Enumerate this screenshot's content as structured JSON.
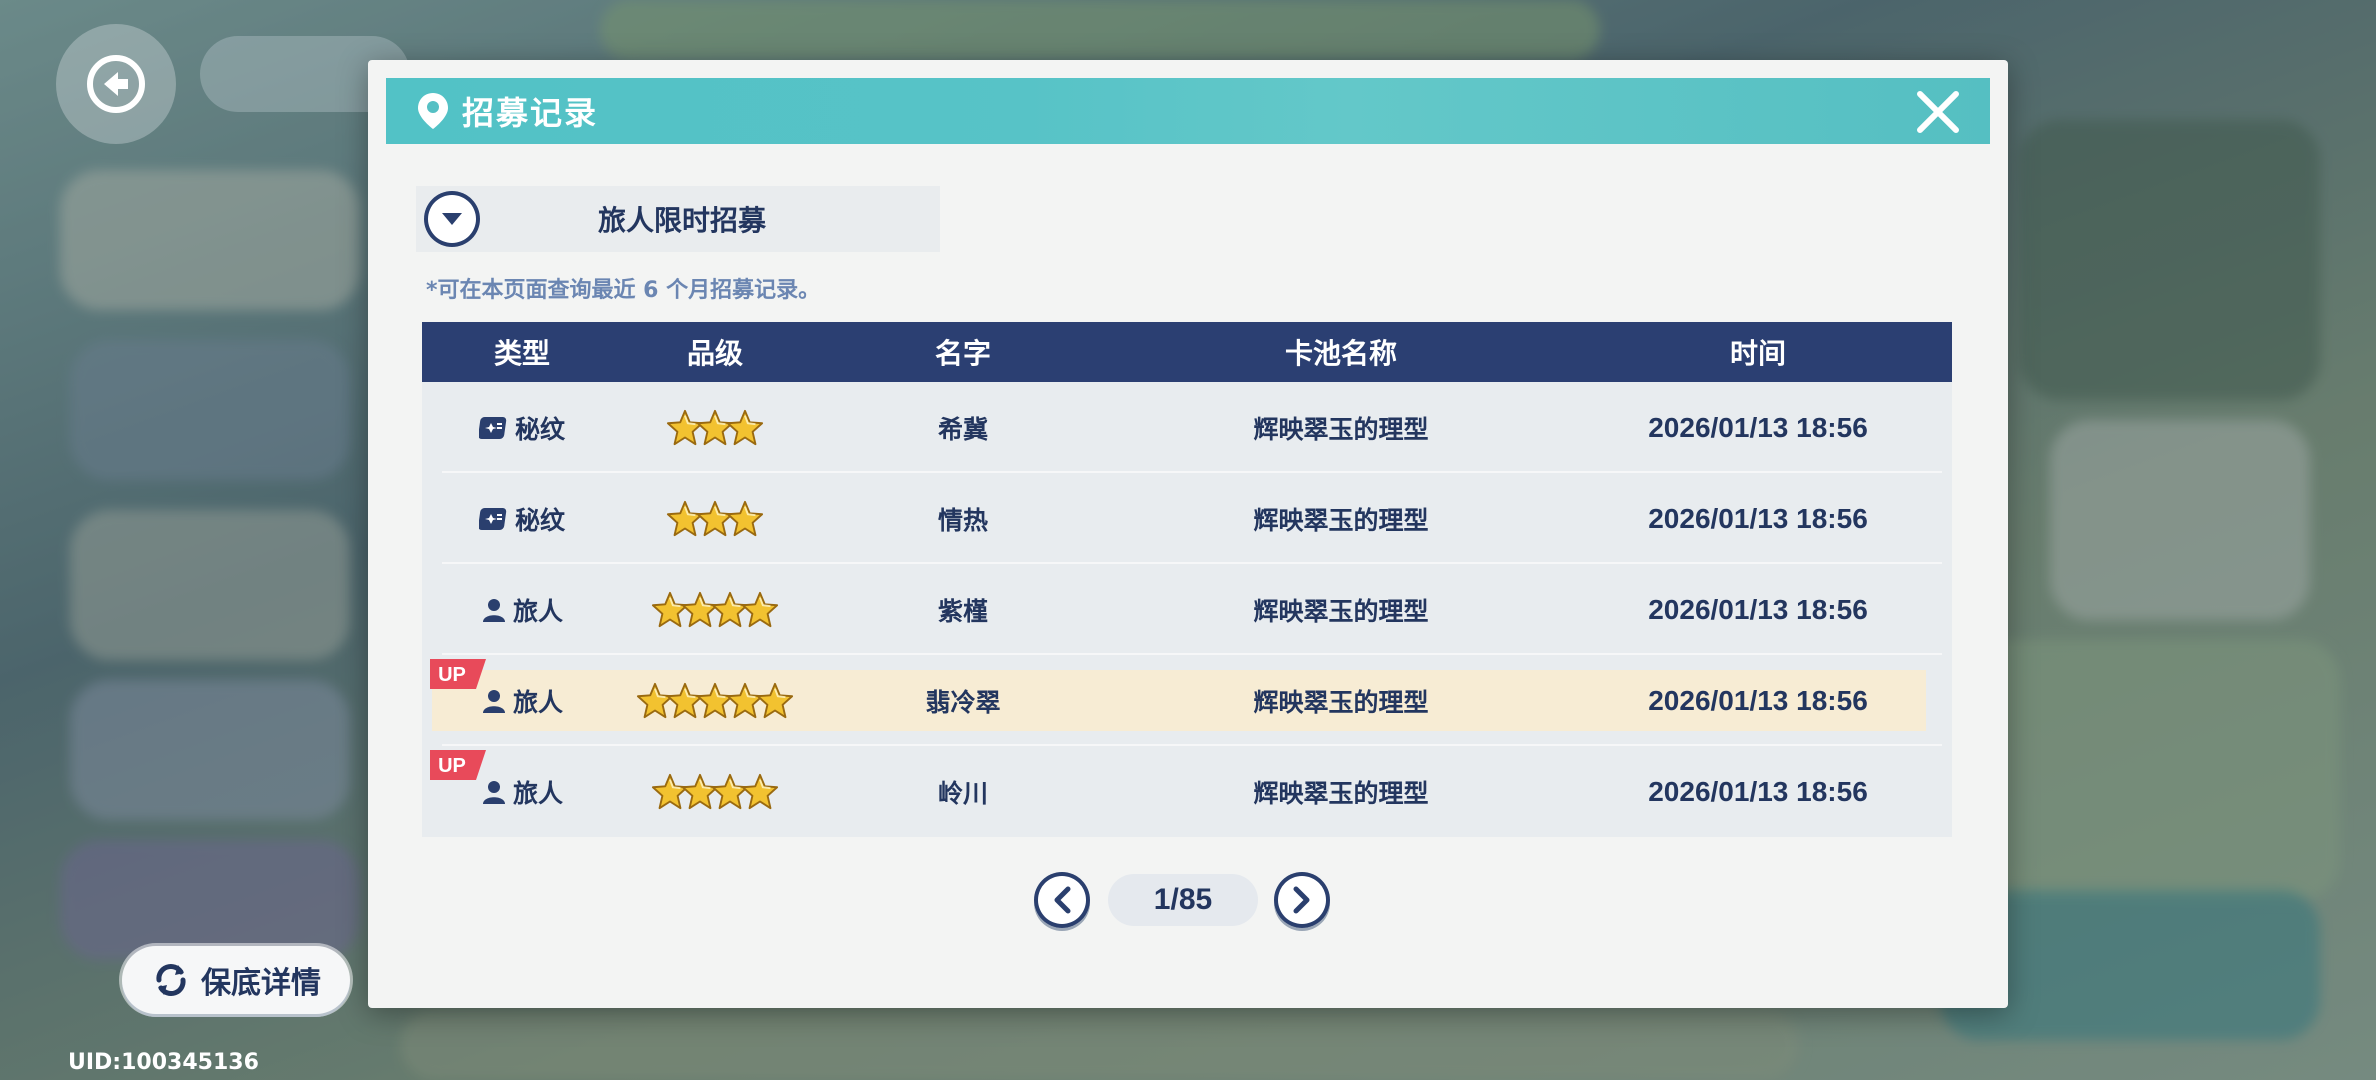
{
  "dialog": {
    "title": "招募记录",
    "pool_selector": "旅人限时招募",
    "note": "*可在本页面查询最近 6 个月招募记录。"
  },
  "table": {
    "headers": {
      "type": "类型",
      "grade": "品级",
      "name": "名字",
      "pool": "卡池名称",
      "time": "时间"
    },
    "rows": [
      {
        "type": "秘纹",
        "type_icon": "rune-icon",
        "stars": 3,
        "up": false,
        "name": "希冀",
        "pool": "辉映翠玉的理型",
        "time": "2026/01/13 18:56"
      },
      {
        "type": "秘纹",
        "type_icon": "rune-icon",
        "stars": 3,
        "up": false,
        "name": "情热",
        "pool": "辉映翠玉的理型",
        "time": "2026/01/13 18:56"
      },
      {
        "type": "旅人",
        "type_icon": "person-icon",
        "stars": 4,
        "up": false,
        "name": "紫槿",
        "pool": "辉映翠玉的理型",
        "time": "2026/01/13 18:56"
      },
      {
        "type": "旅人",
        "type_icon": "person-icon",
        "stars": 5,
        "up": true,
        "up_label": "UP",
        "name": "翡冷翠",
        "pool": "辉映翠玉的理型",
        "time": "2026/01/13 18:56"
      },
      {
        "type": "旅人",
        "type_icon": "person-icon",
        "stars": 4,
        "up": true,
        "up_label": "UP",
        "name": "岭川",
        "pool": "辉映翠玉的理型",
        "time": "2026/01/13 18:56"
      }
    ]
  },
  "pager": {
    "label": "1/85"
  },
  "pity_button": {
    "label": "保底详情"
  },
  "uid": "UID:100345136",
  "colors": {
    "accent": "#55c0c4",
    "header": "#2b3f72",
    "text": "#23365f",
    "highlight": "#f7ecd4",
    "up_badge": "#e84a5a",
    "star": "#f2c230"
  }
}
